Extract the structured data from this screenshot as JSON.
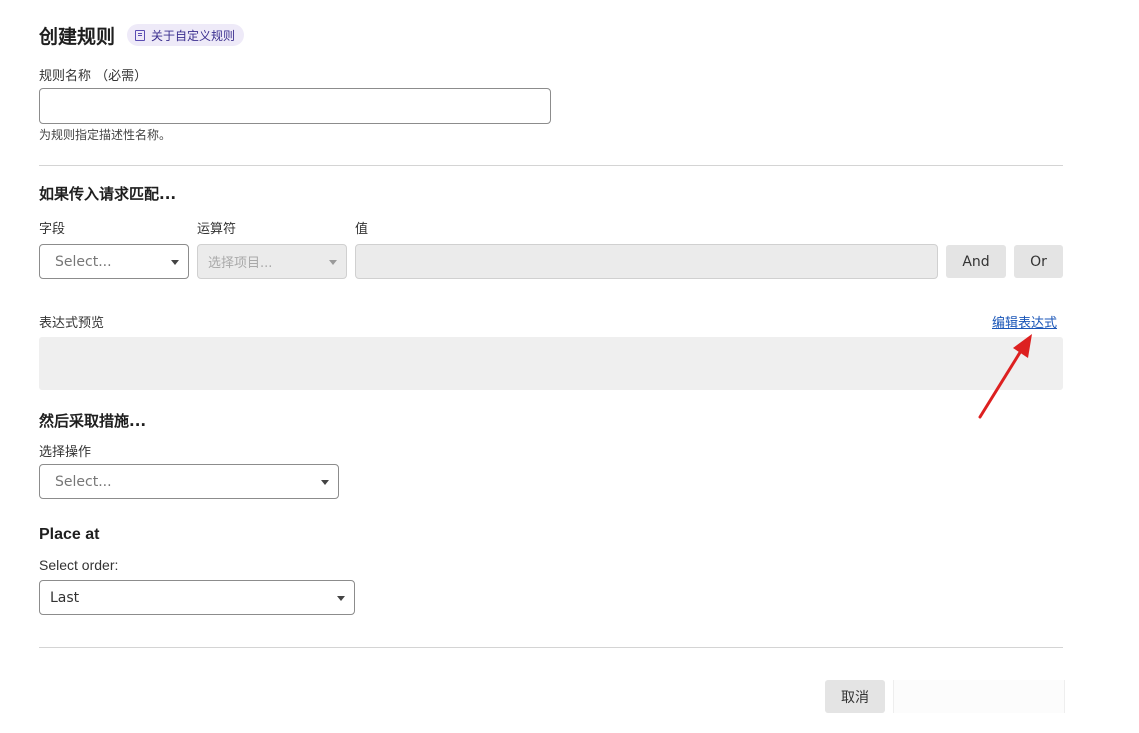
{
  "header": {
    "title": "创建规则",
    "about_link": "关于自定义规则",
    "about_icon": "book-icon"
  },
  "rule_name": {
    "label": "规则名称 （必需）",
    "value": "",
    "help": "为规则指定描述性名称。"
  },
  "condition": {
    "heading": "如果传入请求匹配...",
    "field_label": "字段",
    "operator_label": "运算符",
    "value_label": "值",
    "field_placeholder": "Select...",
    "operator_placeholder": "选择项目...",
    "value_value": "",
    "and_label": "And",
    "or_label": "Or"
  },
  "expression": {
    "label": "表达式预览",
    "edit_link": "编辑表达式",
    "preview_text": ""
  },
  "action": {
    "heading": "然后采取措施...",
    "label": "选择操作",
    "placeholder": "Select..."
  },
  "placement": {
    "heading": "Place at",
    "label": "Select order:",
    "value": "Last"
  },
  "footer": {
    "cancel_label": "取消"
  },
  "colors": {
    "arrow": "#dd2020",
    "link": "#1a56b8",
    "pill_bg": "#eeeaf8"
  }
}
